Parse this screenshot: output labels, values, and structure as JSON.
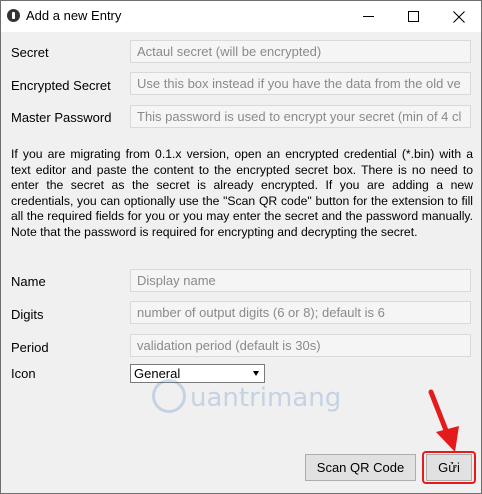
{
  "window": {
    "title": "Add a new Entry"
  },
  "form": {
    "secret": {
      "label": "Secret",
      "placeholder": "Actaul secret (will be encrypted)"
    },
    "encrypted_secret": {
      "label": "Encrypted Secret",
      "placeholder": "Use this box instead if you have the data from the old ve"
    },
    "master_password": {
      "label": "Master Password",
      "placeholder": "This password is used to encrypt your secret (min of 4 cl"
    },
    "info_text": "If you are migrating from 0.1.x version, open an encrypted credential (*.bin) with a text editor and paste the content to the encrypted secret box. There is no need to enter the secret as the secret is already encrypted. If you are adding a new credentials, you can optionally use the \"Scan QR code\" button for the extension to fill all the required fields for you or you may enter the secret and the password manually. Note that the password is required for encrypting and decrypting the secret.",
    "name": {
      "label": "Name",
      "placeholder": "Display name"
    },
    "digits": {
      "label": "Digits",
      "placeholder": "number of output digits (6 or 8); default is 6"
    },
    "period": {
      "label": "Period",
      "placeholder": "validation period (default is 30s)"
    },
    "icon": {
      "label": "Icon",
      "selected": "General"
    }
  },
  "buttons": {
    "scan_qr": "Scan QR Code",
    "send": "Gửi"
  },
  "watermark": {
    "text": "uantrimang"
  },
  "colors": {
    "annotation": "#e51b1b",
    "watermark": "#2d6cb5"
  }
}
